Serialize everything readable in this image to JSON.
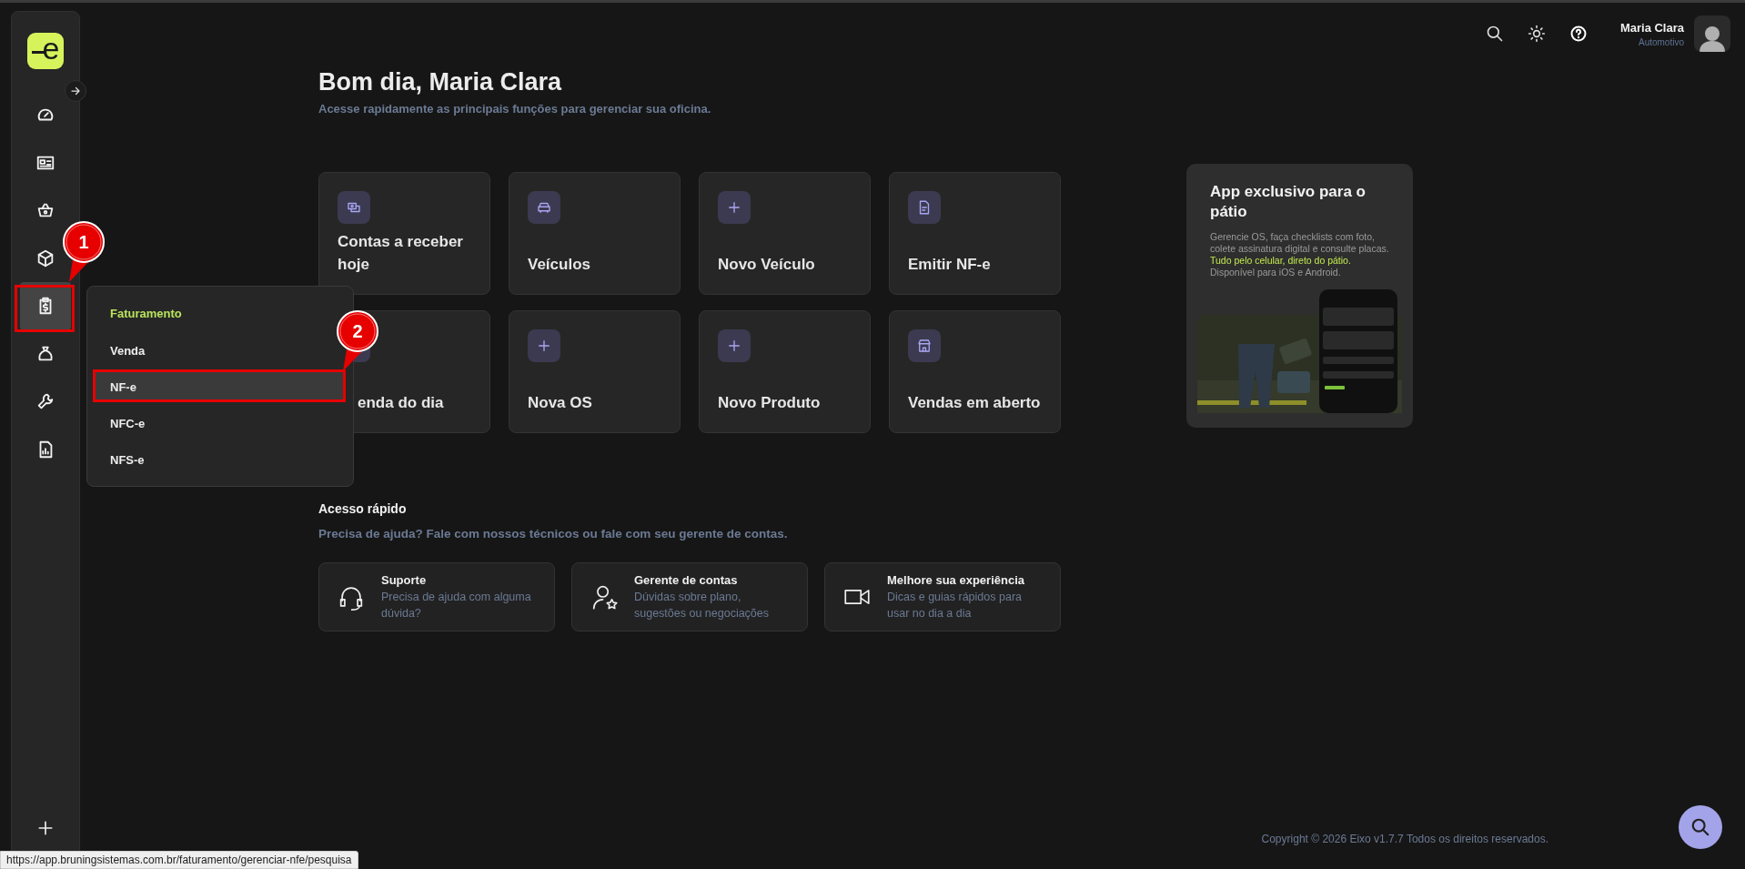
{
  "sidebar": {
    "logo": "e",
    "items": [
      {
        "selected": false
      },
      {
        "selected": false
      },
      {
        "selected": false
      },
      {
        "selected": false
      },
      {
        "selected": true
      },
      {
        "selected": false
      },
      {
        "selected": false
      },
      {
        "selected": false
      }
    ]
  },
  "header": {
    "user_name": "Maria Clara",
    "user_role": "Automotivo"
  },
  "greeting": {
    "title": "Bom dia, Maria Clara",
    "subtitle": "Acesse rapidamente as principais funções para gerenciar sua oficina."
  },
  "shortcuts": [
    {
      "label": "Contas a receber hoje"
    },
    {
      "label": "Veículos"
    },
    {
      "label": "Novo Veículo"
    },
    {
      "label": "Emitir NF-e"
    },
    {
      "label": "enda do dia"
    },
    {
      "label": "Nova OS"
    },
    {
      "label": "Novo Produto"
    },
    {
      "label": "Vendas em aberto"
    }
  ],
  "promo": {
    "title": "App exclusivo para o pátio",
    "body": [
      {
        "text": "Gerencie OS, faça checklists com foto, colete assinatura digital e consulte placas. ",
        "highlight": false
      },
      {
        "text": "Tudo pelo celular, direto do pátio.",
        "highlight": true
      },
      {
        "text": " Disponível para iOS e Android.",
        "highlight": false
      }
    ]
  },
  "quick_access": {
    "title": "Acesso rápido",
    "subtitle": "Precisa de ajuda? Fale com nossos técnicos ou fale com seu gerente de contas.",
    "cards": [
      {
        "title": "Suporte",
        "description": "Precisa de ajuda com alguma dúvida?"
      },
      {
        "title": "Gerente de contas",
        "description": "Dúvidas sobre plano, sugestões ou negociações"
      },
      {
        "title": "Melhore sua experiência",
        "description": "Dicas e guias rápidos para usar no dia a dia"
      }
    ]
  },
  "footer": {
    "copyright": "Copyright © 2026 Eixo v1.7.7 Todos os direitos reservados."
  },
  "flyout_menu": {
    "title": "Faturamento",
    "items": [
      {
        "label": "Venda",
        "selected": false
      },
      {
        "label": "NF-e",
        "selected": true
      },
      {
        "label": "NFC-e",
        "selected": false
      },
      {
        "label": "NFS-e",
        "selected": false
      }
    ]
  },
  "annotations": [
    {
      "number": "1"
    },
    {
      "number": "2"
    }
  ],
  "status_bar": {
    "url": "https://app.bruningsistemas.com.br/faturamento/gerenciar-nfe/pesquisa"
  }
}
